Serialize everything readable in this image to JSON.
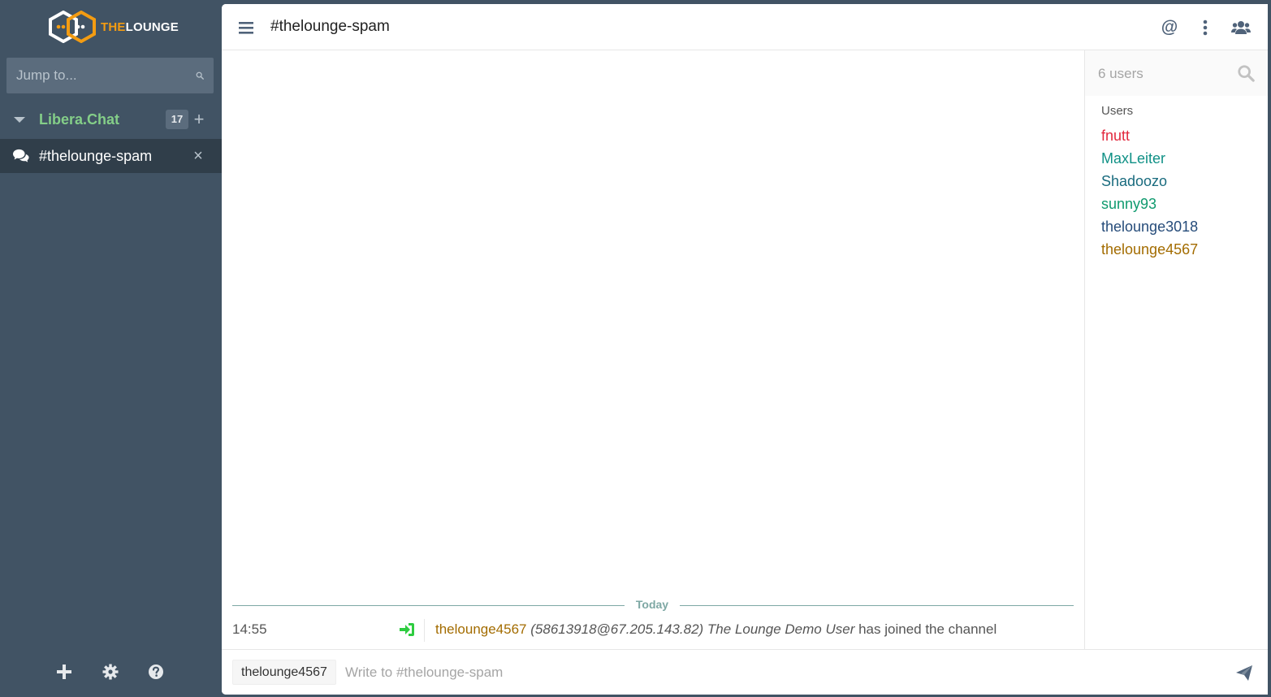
{
  "app": {
    "logo_prefix": "THE",
    "logo_suffix": "LOUNGE"
  },
  "sidebar": {
    "jump_placeholder": "Jump to...",
    "network": {
      "name": "Libera.Chat",
      "unread_count": "17",
      "add_label": "+"
    },
    "channel": {
      "name": "#thelounge-spam",
      "close_label": "×"
    },
    "footer": {
      "add_icon": "plus-icon",
      "settings_icon": "gear-icon",
      "help_icon": "help-circle-icon"
    }
  },
  "header": {
    "title": "#thelounge-spam",
    "mention_label": "@"
  },
  "chat": {
    "date_marker": "Today",
    "messages": [
      {
        "time": "14:55",
        "nick": "thelounge4567",
        "host": "(58613918@67.205.143.82)",
        "realname": "The Lounge Demo User",
        "action": "has joined the channel"
      }
    ]
  },
  "userlist": {
    "search_placeholder": "6 users",
    "heading": "Users",
    "users": [
      {
        "name": "fnutt",
        "color": "#e2283d"
      },
      {
        "name": "MaxLeiter",
        "color": "#109186"
      },
      {
        "name": "Shadoozo",
        "color": "#196b7e"
      },
      {
        "name": "sunny93",
        "color": "#0f9a6e"
      },
      {
        "name": "thelounge3018",
        "color": "#264c7a"
      },
      {
        "name": "thelounge4567",
        "color": "#a36c00"
      }
    ]
  },
  "input": {
    "nick": "thelounge4567",
    "placeholder": "Write to #thelounge-spam"
  },
  "colors": {
    "sidebar_bg": "#415364",
    "active_channel_bg": "#303e4a",
    "network_name": "#84ce88",
    "accent": "#f39c12",
    "join_icon": "#2ecc40",
    "date_marker": "#7ea8a4"
  }
}
